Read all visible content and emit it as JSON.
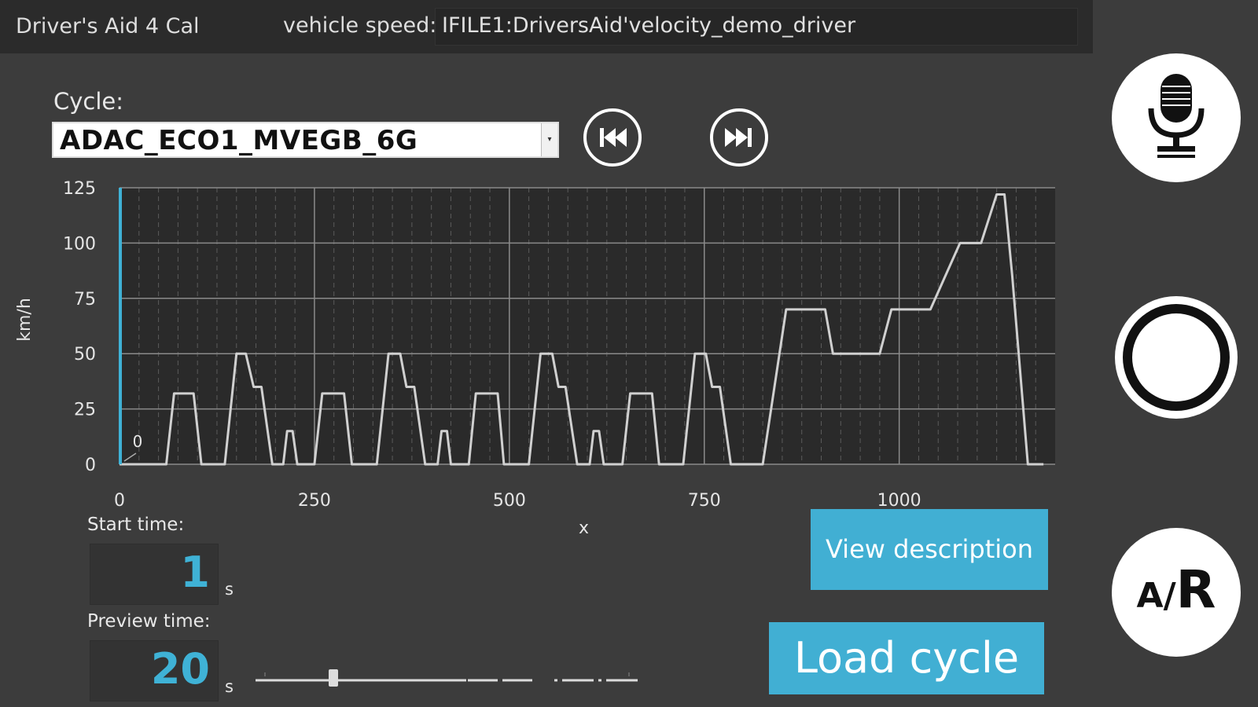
{
  "header": {
    "title": "Driver's Aid 4 Cal",
    "vehicle_speed_label": "vehicle speed:",
    "vehicle_speed_value": "IFILE1:DriversAid'velocity_demo_driver"
  },
  "cycle": {
    "label": "Cycle:",
    "selected": "ADAC_ECO1_MVEGB_6G"
  },
  "controls": {
    "start_time_label": "Start time:",
    "start_time_value": "1",
    "start_time_unit": "s",
    "preview_time_label": "Preview time:",
    "preview_time_value": "20",
    "preview_time_unit": "s",
    "view_description": "View description",
    "load_cycle": "Load cycle"
  },
  "side": {
    "ar_label": "A/R"
  },
  "colors": {
    "accent": "#41afd3",
    "value_text": "#3fb2d6",
    "background": "#3c3c3c",
    "plot_bg": "#2a2a2a"
  },
  "chart_data": {
    "type": "line",
    "title": "",
    "xlabel": "x",
    "ylabel": "km/h",
    "xlim": [
      0,
      1200
    ],
    "ylim": [
      0,
      125
    ],
    "xticks": [
      0,
      250,
      500,
      750,
      1000
    ],
    "yticks": [
      0,
      25,
      50,
      75,
      100,
      125
    ],
    "grid": true,
    "cursor_x": 1,
    "marker_label": "0",
    "series": [
      {
        "values": [
          [
            0,
            0
          ],
          [
            35,
            0
          ],
          [
            45,
            0
          ],
          [
            60,
            0
          ],
          [
            70,
            32
          ],
          [
            95,
            32
          ],
          [
            105,
            0
          ],
          [
            130,
            0
          ],
          [
            135,
            0
          ],
          [
            150,
            50
          ],
          [
            162,
            50
          ],
          [
            172,
            35
          ],
          [
            182,
            35
          ],
          [
            196,
            0
          ],
          [
            210,
            0
          ],
          [
            215,
            15
          ],
          [
            222,
            15
          ],
          [
            228,
            0
          ],
          [
            250,
            0
          ],
          [
            260,
            32
          ],
          [
            288,
            32
          ],
          [
            298,
            0
          ],
          [
            325,
            0
          ],
          [
            330,
            0
          ],
          [
            345,
            50
          ],
          [
            360,
            50
          ],
          [
            368,
            35
          ],
          [
            378,
            35
          ],
          [
            392,
            0
          ],
          [
            408,
            0
          ],
          [
            413,
            15
          ],
          [
            420,
            15
          ],
          [
            425,
            0
          ],
          [
            448,
            0
          ],
          [
            457,
            32
          ],
          [
            485,
            32
          ],
          [
            493,
            0
          ],
          [
            520,
            0
          ],
          [
            525,
            0
          ],
          [
            540,
            50
          ],
          [
            555,
            50
          ],
          [
            563,
            35
          ],
          [
            572,
            35
          ],
          [
            587,
            0
          ],
          [
            603,
            0
          ],
          [
            608,
            15
          ],
          [
            615,
            15
          ],
          [
            621,
            0
          ],
          [
            645,
            0
          ],
          [
            655,
            32
          ],
          [
            683,
            32
          ],
          [
            692,
            0
          ],
          [
            718,
            0
          ],
          [
            723,
            0
          ],
          [
            738,
            50
          ],
          [
            752,
            50
          ],
          [
            760,
            35
          ],
          [
            770,
            35
          ],
          [
            784,
            0
          ],
          [
            798,
            0
          ],
          [
            825,
            0
          ],
          [
            855,
            70
          ],
          [
            905,
            70
          ],
          [
            915,
            50
          ],
          [
            975,
            50
          ],
          [
            990,
            70
          ],
          [
            1040,
            70
          ],
          [
            1078,
            100
          ],
          [
            1105,
            100
          ],
          [
            1125,
            122
          ],
          [
            1135,
            122
          ],
          [
            1145,
            85
          ],
          [
            1165,
            0
          ],
          [
            1185,
            0
          ]
        ]
      }
    ]
  }
}
